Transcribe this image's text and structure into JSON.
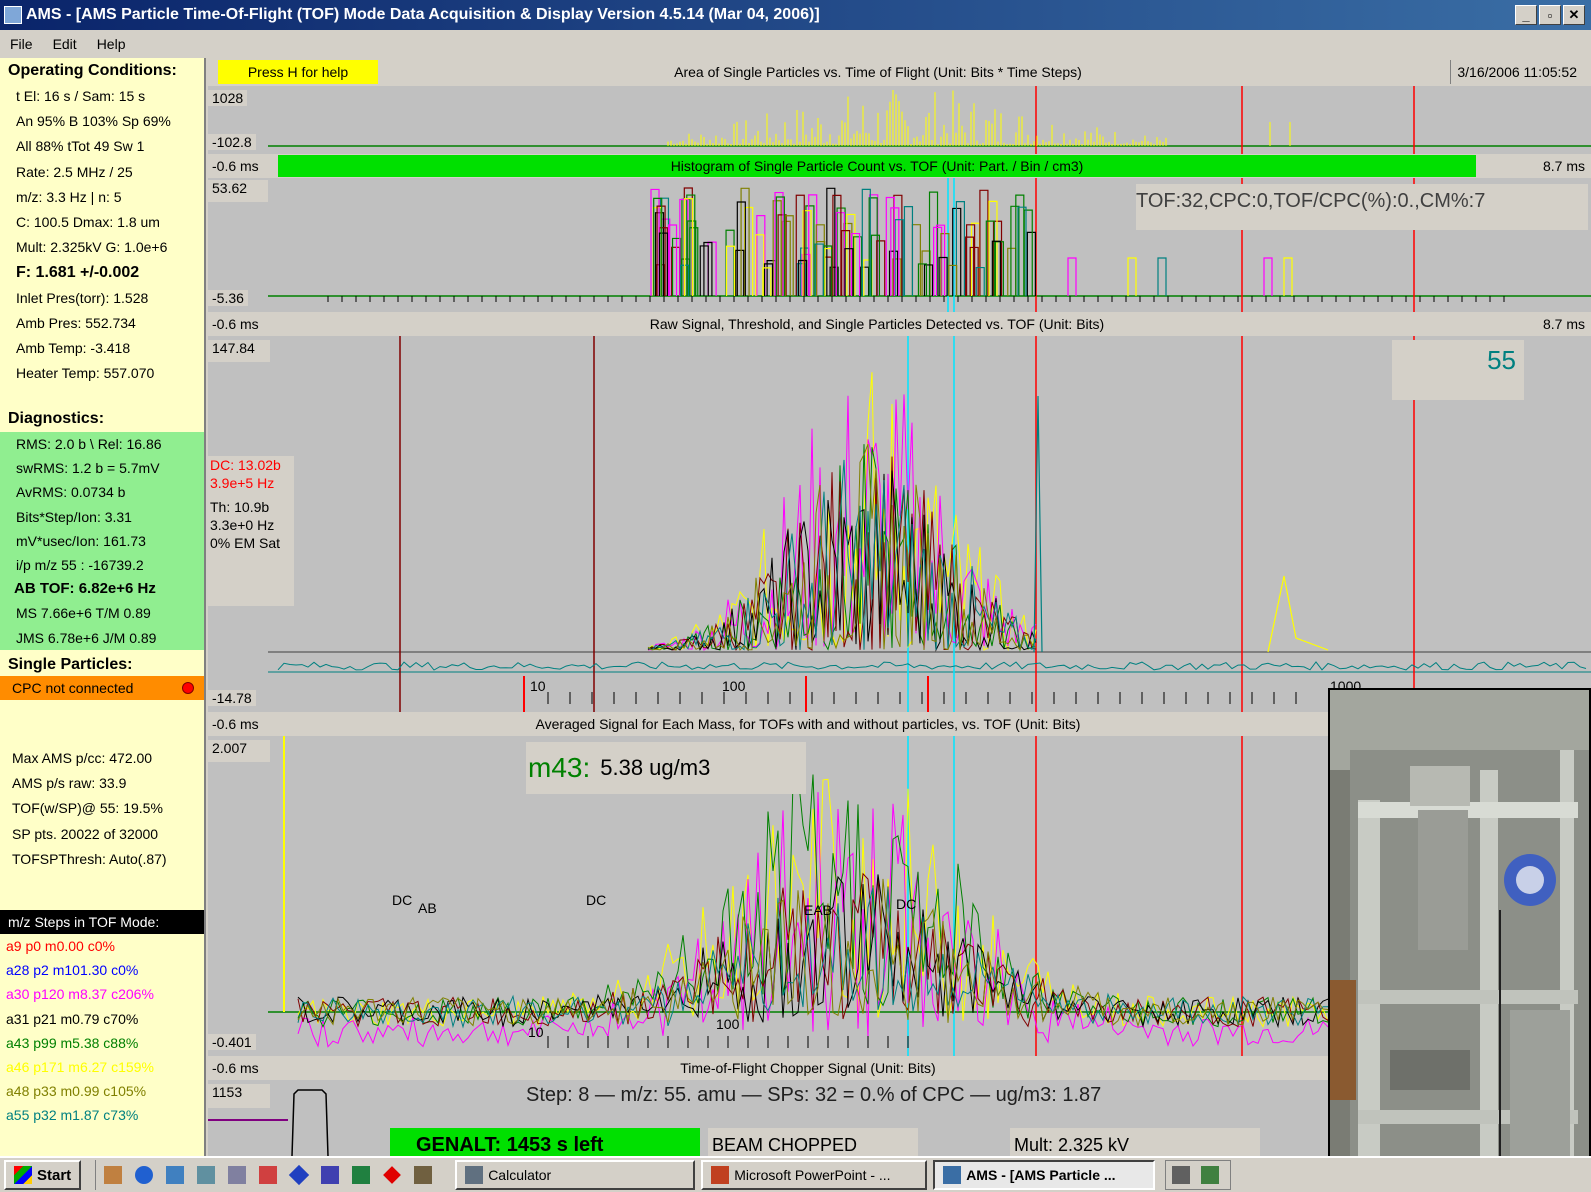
{
  "window": {
    "title": "AMS - [AMS Particle Time-Of-Flight (TOF) Mode Data Acquisition & Display Version 4.5.14 (Mar 04, 2006)]",
    "min": "_",
    "max": "▫",
    "close": "✕"
  },
  "menu": {
    "items": [
      "File",
      "Edit",
      "Help"
    ]
  },
  "operating": {
    "heading": "Operating Conditions:",
    "lines": [
      "t El:  16 s / Sam: 15 s",
      "An 95% B 103% Sp 69%",
      "All 88% tTot 49 Sw  1",
      "Rate: 2.5 MHz /  25",
      "m/z: 3.3 Hz | n: 5",
      "C: 100.5  Dmax: 1.8 um",
      "Mult: 2.325kV G: 1.0e+6",
      "F: 1.681 +/-0.002",
      "Inlet Pres(torr): 1.528",
      "Amb Pres: 552.734",
      "Amb Temp: -3.418",
      "Heater Temp: 557.070"
    ]
  },
  "diagnostics": {
    "heading": "Diagnostics:",
    "lines": [
      "RMS: 2.0 b \\ Rel: 16.86",
      "swRMS: 1.2 b = 5.7mV",
      "AvRMS: 0.0734 b",
      "Bits*Step/Ion: 3.31",
      "mV*usec/Ion: 161.73",
      "i/p m/z 55 : -16739.2",
      "AB TOF: 6.82e+6 Hz",
      "MS  7.66e+6  T/M 0.89",
      "JMS 6.78e+6  J/M 0.89"
    ]
  },
  "single_particles": {
    "heading": "Single Particles:",
    "cpc_status": "CPC not connected",
    "lines": [
      "Max AMS p/cc: 472.00",
      "AMS p/s raw: 33.9",
      "TOF(w/SP)@ 55: 19.5%",
      "SP pts. 20022 of  32000",
      "TOFSPThresh: Auto(.87)"
    ]
  },
  "mz_steps": {
    "heading": "m/z Steps in TOF Mode:",
    "items": [
      {
        "text": "a9 p0 m0.00 c0%",
        "color": "#ff0000",
        "bg": "#ffffc8"
      },
      {
        "text": "a28 p2 m101.30 c0%",
        "color": "#0000ff",
        "bg": "#ffffc8"
      },
      {
        "text": "a30 p120 m8.37 c206%",
        "color": "#ff00ff",
        "bg": "#ffffc8"
      },
      {
        "text": "a31 p21 m0.79 c70%",
        "color": "#000000",
        "bg": "#ffffc8"
      },
      {
        "text": "a43 p99 m5.38 c88%",
        "color": "#008000",
        "bg": "#ffffc8"
      },
      {
        "text": "a46 p171 m6.27 c159%",
        "color": "#ffff00",
        "bg": "#ffffc8"
      },
      {
        "text": "a48 p33 m0.99 c105%",
        "color": "#808000",
        "bg": "#ffffc8"
      },
      {
        "text": "a55 p32 m1.87 c73%",
        "color": "#008080",
        "bg": "#ffffc8"
      }
    ]
  },
  "top_bar": {
    "help": "Press H for help",
    "area_title": "Area of Single Particles vs. Time of Flight  (Unit: Bits * Time Steps)",
    "timestamp": "3/16/2006 11:05:52"
  },
  "panels": {
    "area": {
      "ymax": "1028",
      "ymin": "-102.8"
    },
    "histogram": {
      "left": "-0.6 ms",
      "right": "8.7 ms",
      "title": "Histogram of Single Particle Count vs. TOF   (Unit: Part. / Bin / cm3)",
      "ymax": "53.62",
      "ymin": "-5.36",
      "stats": "TOF:32,CPC:0,TOF/CPC(%):0.,CM%:7"
    },
    "raw": {
      "left": "-0.6 ms",
      "right": "8.7 ms",
      "title": "Raw Signal, Threshold, and Single Particles Detected vs. TOF   (Unit: Bits)",
      "ymax": "147.84",
      "ymin": "-14.78",
      "mass": "55",
      "dc1": "DC: 13.02b",
      "dc2": "3.9e+5 Hz",
      "th1": "Th: 10.9b",
      "th2": "3.3e+0 Hz",
      "th3": "0% EM Sat",
      "tick10": "10",
      "tick100": "100",
      "tick1000": "1000"
    },
    "avg": {
      "left": "-0.6 ms",
      "title": "Averaged Signal for Each Mass, for TOFs with and without particles, vs. TOF   (Unit: Bits)",
      "ymax": "2.007",
      "ymin": "-0.401",
      "mass_label": "m43:",
      "mass_value": "5.38 ug/m3",
      "dc_ab": "DC",
      "ab": "AB",
      "dc2": "DC",
      "eab": "EAB",
      "dc3": "DC",
      "tick10": "10",
      "tick100": "100"
    },
    "chopper": {
      "left": "-0.6 ms",
      "title": "Time-of-Flight Chopper Signal  (Unit: Bits)",
      "ymax": "1153",
      "step": "Step:  8 — m/z: 55. amu — SPs: 32 = 0.% of CPC  — ug/m3: 1.87",
      "genalt": "GENALT: 1453 s left",
      "beam": "BEAM CHOPPED",
      "mult": "Mult: 2.325 kV"
    }
  },
  "taskbar": {
    "start": "Start",
    "calc": "Calculator",
    "ppt": "Microsoft PowerPoint - ...",
    "ams": "AMS - [AMS Particle ..."
  },
  "colors": {
    "yellow": "#ffff00",
    "magenta": "#ff00ff",
    "green": "#008000",
    "teal": "#008080",
    "darkred": "#800000",
    "red": "#ff0000",
    "black": "#000000",
    "cyan": "#00e5ff",
    "olive": "#808000"
  }
}
